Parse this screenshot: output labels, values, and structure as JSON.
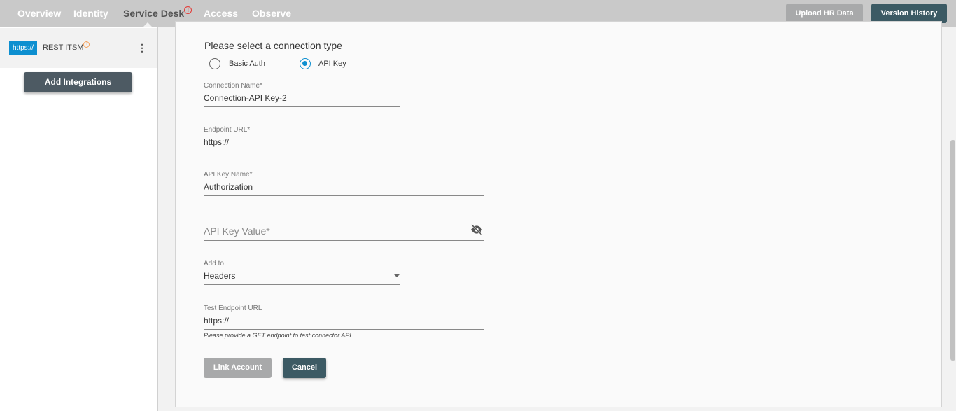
{
  "nav": {
    "tabs": [
      {
        "label": "Overview"
      },
      {
        "label": "Identity"
      },
      {
        "label": "Service Desk",
        "active": true,
        "alert": "!"
      },
      {
        "label": "Access"
      },
      {
        "label": "Observe"
      }
    ],
    "upload_label": "Upload HR Data",
    "version_label": "Version History"
  },
  "sidebar": {
    "item": {
      "badge": "https://",
      "name": "REST ITSM",
      "alert": "!",
      "menu": "⋮"
    },
    "add_label": "Add Integrations"
  },
  "form": {
    "prompt": "Please select a connection type",
    "options": [
      {
        "label": "Basic Auth",
        "selected": false
      },
      {
        "label": "API Key",
        "selected": true
      }
    ],
    "connection_name": {
      "label": "Connection Name*",
      "value": "Connection-API Key-2"
    },
    "endpoint_url": {
      "label": "Endpoint URL*",
      "value": "https://"
    },
    "api_key_name": {
      "label": "API Key Name*",
      "value": "Authorization"
    },
    "api_key_value": {
      "placeholder": "API Key Value*",
      "icon": "eye-off-icon"
    },
    "add_to": {
      "label": "Add to",
      "value": "Headers"
    },
    "test_endpoint": {
      "label": "Test Endpoint URL",
      "value": "https://",
      "hint": "Please provide a GET endpoint to test connector API"
    },
    "link_label": "Link Account",
    "cancel_label": "Cancel"
  },
  "colors": {
    "accent": "#0d8fd0",
    "dark_button": "#3c5a64",
    "disabled_button": "#a8a9aa",
    "alert": "#e53935"
  }
}
